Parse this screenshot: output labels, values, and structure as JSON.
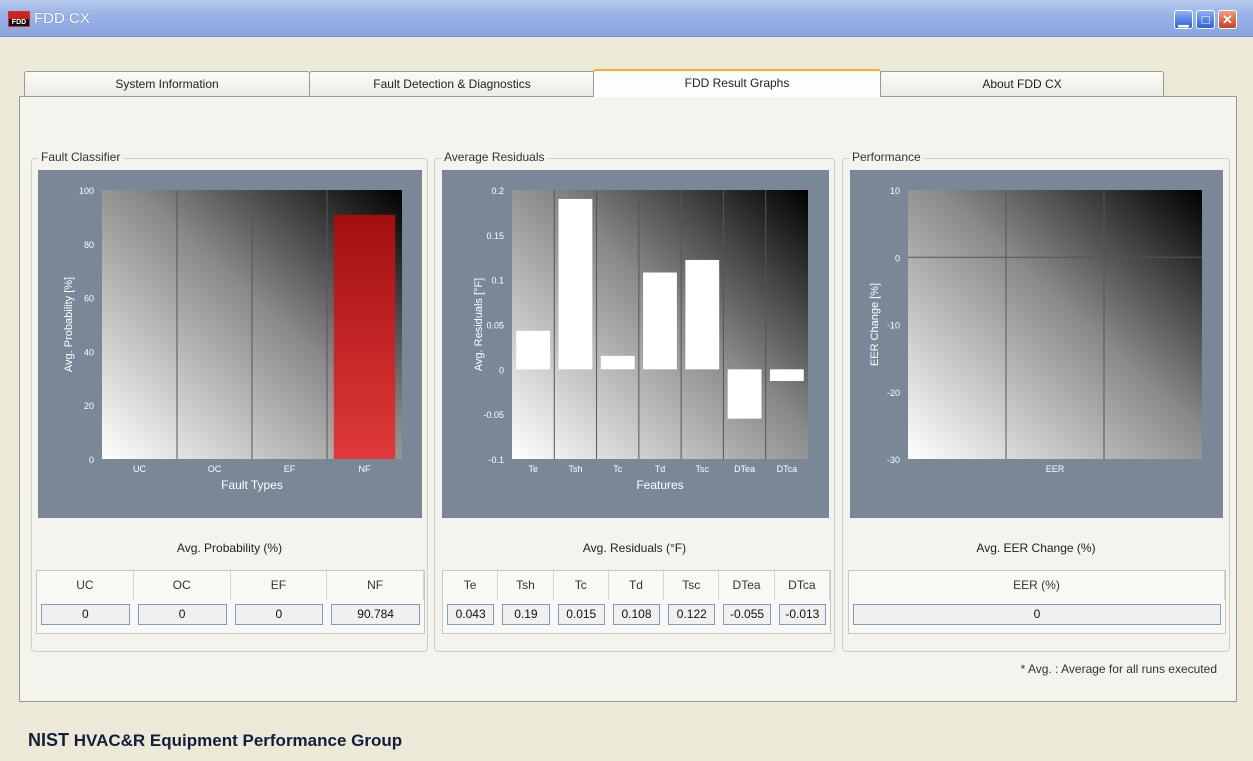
{
  "window": {
    "title": "FDD CX",
    "icon_text": "FDD"
  },
  "tabs": [
    {
      "label": "System Information"
    },
    {
      "label": "Fault Detection & Diagnostics"
    },
    {
      "label": "FDD Result Graphs"
    },
    {
      "label": "About FDD CX"
    }
  ],
  "active_tab": 2,
  "groups": {
    "fault_classifier": {
      "label": "Fault Classifier",
      "caption": "Avg. Probability (%)"
    },
    "average_residuals": {
      "label": "Average Residuals",
      "caption": "Avg. Residuals (°F)"
    },
    "performance": {
      "label": "Performance",
      "caption": "Avg. EER Change (%)"
    }
  },
  "chart_data": [
    {
      "type": "bar",
      "categories": [
        "UC",
        "OC",
        "EF",
        "NF"
      ],
      "values": [
        0,
        0,
        0,
        90.784
      ],
      "xlabel": "Fault Types",
      "ylabel": "Avg. Probability [%]",
      "ylim": [
        0,
        100
      ],
      "yticks": [
        "0",
        "20",
        "40",
        "60",
        "80",
        "100"
      ],
      "bar_color": "#c41a1a",
      "grid": true
    },
    {
      "type": "bar",
      "categories": [
        "Te",
        "Tsh",
        "Tc",
        "Td",
        "Tsc",
        "DTea",
        "DTca"
      ],
      "values": [
        0.043,
        0.19,
        0.015,
        0.108,
        0.122,
        -0.055,
        -0.013
      ],
      "xlabel": "Features",
      "ylabel": "Avg. Residuals [°F]",
      "ylim": [
        -0.1,
        0.2
      ],
      "yticks": [
        "-0.1",
        "-0.05",
        "0",
        "0.05",
        "0.1",
        "0.15",
        "0.2"
      ],
      "bar_color": "#ffffff",
      "grid": true
    },
    {
      "type": "bar",
      "categories": [
        "EER"
      ],
      "values": [
        0
      ],
      "xlabel": "",
      "ylabel": "EER Change [%]",
      "ylim": [
        -30,
        10
      ],
      "yticks": [
        "-30",
        "-20",
        "-10",
        "0",
        "10"
      ],
      "bar_color": "#ffffff",
      "grid": true
    }
  ],
  "tables": {
    "fault_classifier": {
      "headers": [
        "UC",
        "OC",
        "EF",
        "NF"
      ],
      "values": [
        "0",
        "0",
        "0",
        "90.784"
      ]
    },
    "average_residuals": {
      "headers": [
        "Te",
        "Tsh",
        "Tc",
        "Td",
        "Tsc",
        "DTea",
        "DTca"
      ],
      "values": [
        "0.043",
        "0.19",
        "0.015",
        "0.108",
        "0.122",
        "-0.055",
        "-0.013"
      ]
    },
    "performance": {
      "headers": [
        "EER (%)"
      ],
      "values": [
        "0"
      ]
    }
  },
  "footnote": "* Avg. : Average for all runs executed",
  "footer": {
    "org": "NIST",
    "group": "HVAC&R Equipment Performance Group"
  }
}
